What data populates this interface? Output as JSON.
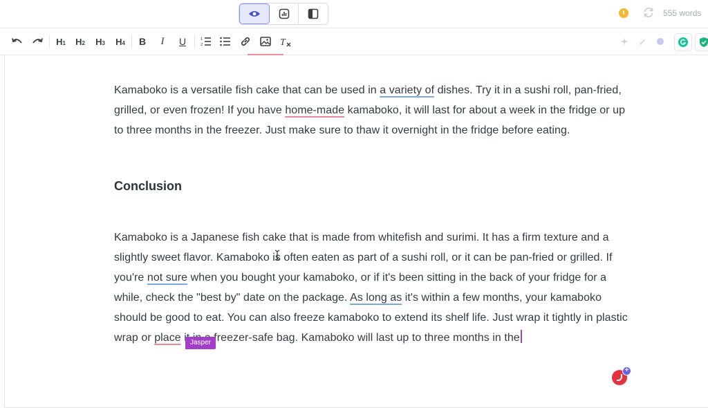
{
  "topbar": {
    "views": [
      {
        "icon": "eye-icon",
        "active": true
      },
      {
        "icon": "stats-icon",
        "active": false
      },
      {
        "icon": "sidebar-layout-icon",
        "active": false
      }
    ],
    "word_count": "555 words"
  },
  "toolbar": {
    "headings": [
      {
        "letter": "H",
        "num": "1"
      },
      {
        "letter": "H",
        "num": "2"
      },
      {
        "letter": "H",
        "num": "3"
      },
      {
        "letter": "H",
        "num": "4"
      }
    ],
    "bold": "B",
    "italic": "I",
    "underline": "U",
    "clear_format": "T"
  },
  "document": {
    "p1": {
      "t1": "Kamaboko is a versatile fish cake that can be used in ",
      "u1": "a variety of",
      "t2": " dishes. Try it in a sushi roll, pan-fried, grilled, or even frozen! If you have ",
      "u2": "home-made",
      "t3": " kamaboko, it will last for about a week in the fridge or up to three months in the freezer. Just make sure to thaw it overnight in the fridge before eating."
    },
    "heading": "Conclusion",
    "p2": {
      "t1": "Kamaboko is a Japanese fish cake that is made from whitefish and surimi. It has a firm texture and a slightly sweet flavor. Kamaboko is often eaten as part of a sushi roll, or it can be pan-fried or grilled. If you're ",
      "u1": "not sure",
      "t2": " when you bought your kamaboko, or if it's been sitting in the back of your fridge for a while, check the \"best by\" date on the package. ",
      "u2": "As long as",
      "t3": " it's within a few months, your kamaboko should be good to eat. You can also freeze kamaboko to extend its shelf life. Just wrap it tightly in plastic wrap or ",
      "u3": "place",
      "t4": " it in a freezer-safe bag. Kamaboko will last up to three months in the"
    },
    "cursor_tag": "Jasper"
  },
  "fab": {
    "badge": "+"
  }
}
